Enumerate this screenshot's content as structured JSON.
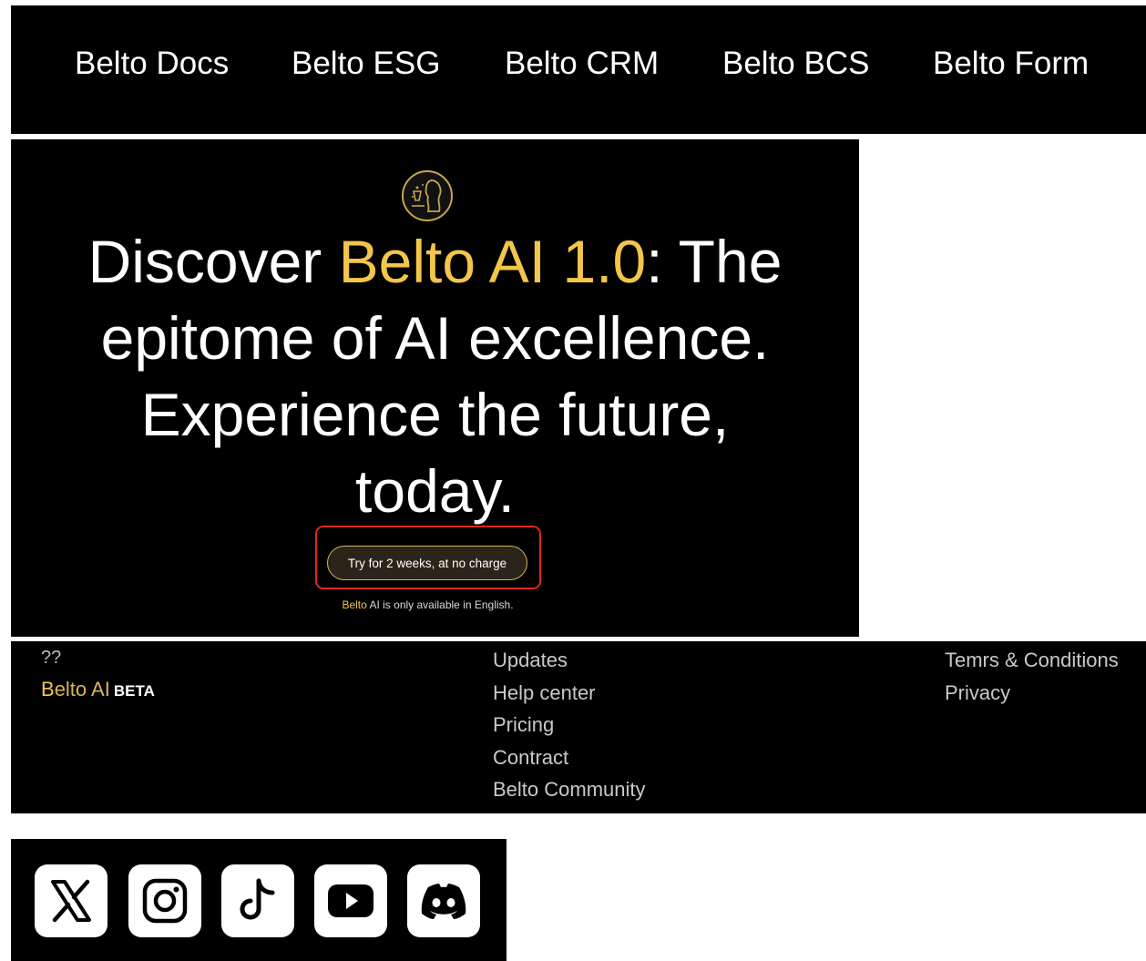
{
  "nav": {
    "items": [
      {
        "label": "Belto Docs"
      },
      {
        "label": "Belto ESG"
      },
      {
        "label": "Belto CRM"
      },
      {
        "label": "Belto BCS"
      },
      {
        "label": "Belto Form"
      }
    ]
  },
  "hero": {
    "logo_icon": "belto-emblem-icon",
    "headline": {
      "pre": "Discover ",
      "accent": "Belto AI 1.0",
      "post_first": ": The",
      "line2": "epitome of AI excellence.",
      "line3": "Experience the future,",
      "line4": "today."
    },
    "cta_label": "Try for 2 weeks, at no charge",
    "note": {
      "accent": "Belto",
      "rest": " AI is only available in English."
    },
    "colors": {
      "accent": "#f3c64a",
      "highlight_border": "#e0251b"
    }
  },
  "footer": {
    "brand_placeholder": "??",
    "brand": {
      "first_letter": "B",
      "rest": "elto AI",
      "badge": "BETA"
    },
    "col2": [
      "Updates",
      "Help center",
      "Pricing",
      "Contract",
      "Belto Community"
    ],
    "col3": [
      "Temrs & Conditions",
      "Privacy"
    ]
  },
  "social": {
    "icons": [
      "x-icon",
      "instagram-icon",
      "tiktok-icon",
      "youtube-icon",
      "discord-icon"
    ]
  }
}
